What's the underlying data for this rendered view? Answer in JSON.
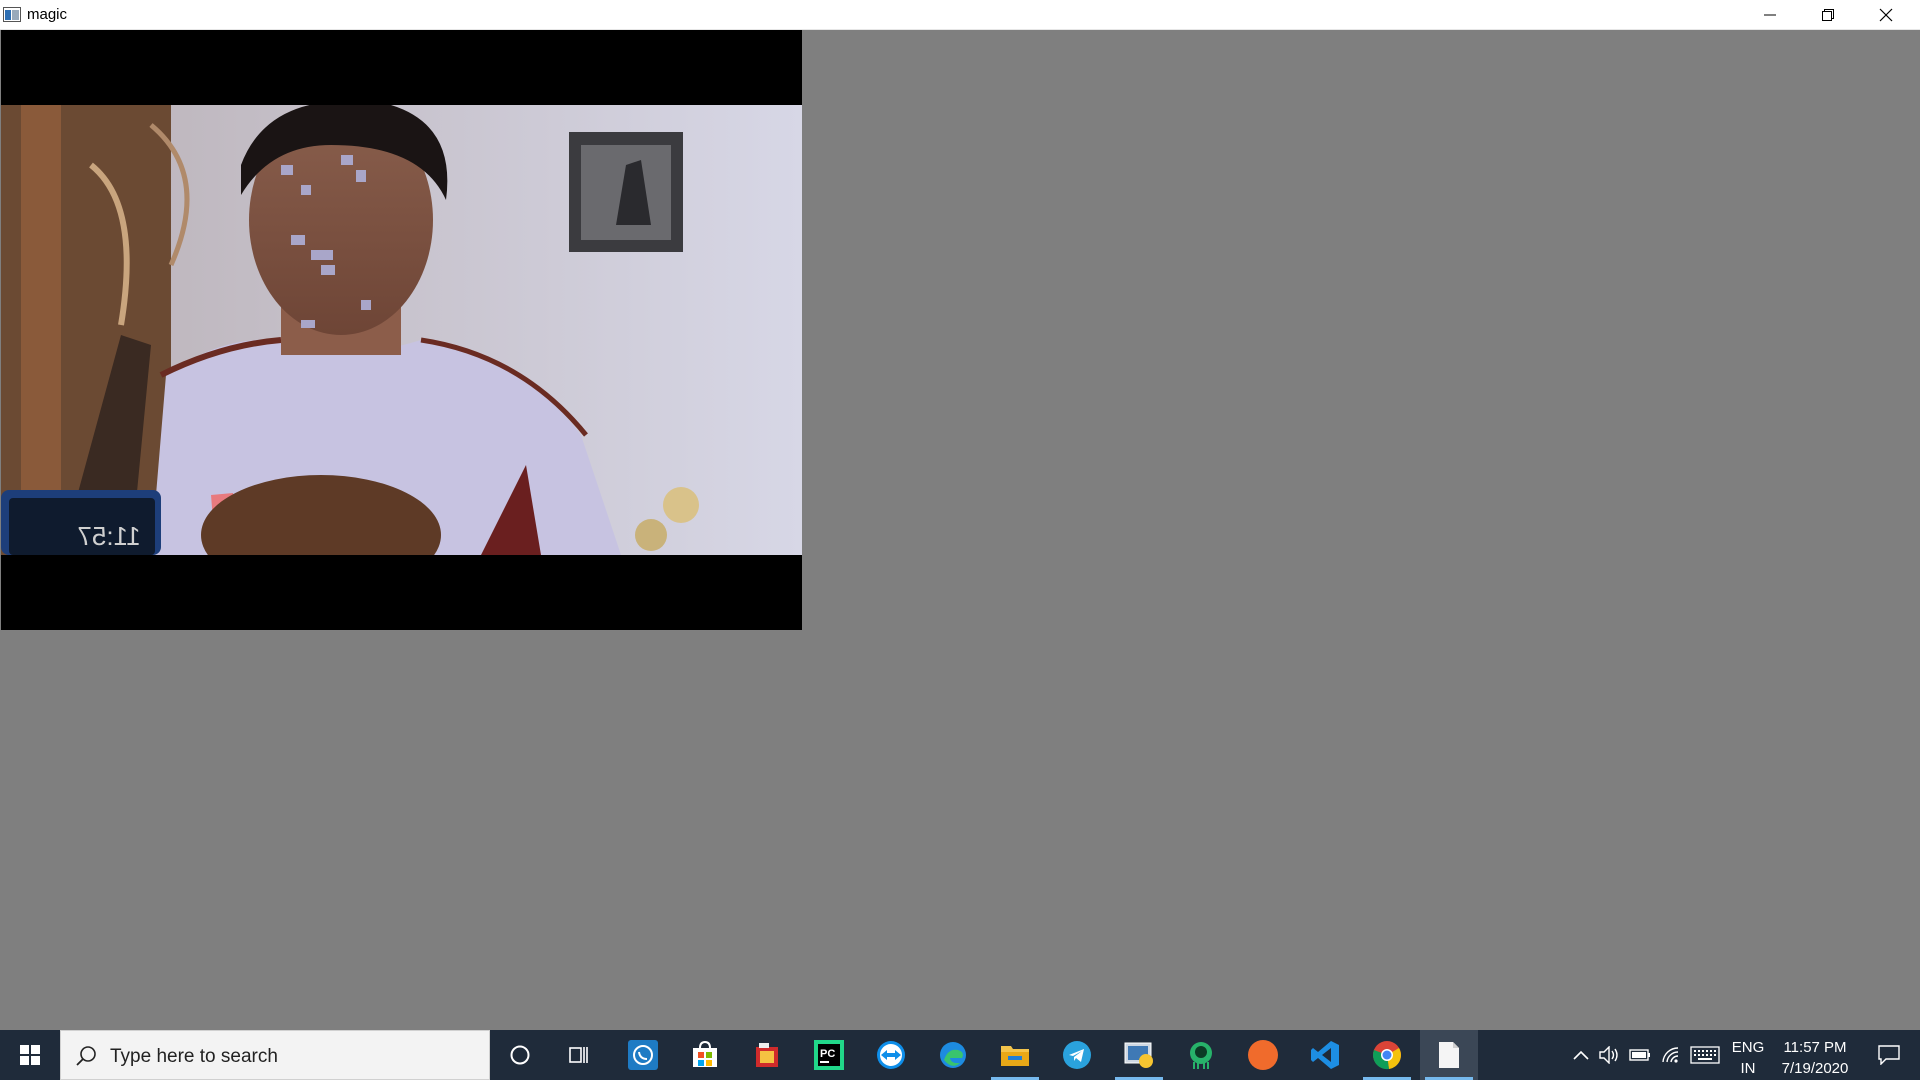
{
  "window": {
    "title": "magic",
    "controls": {
      "minimize": "minimize-icon",
      "restore": "restore-icon",
      "close": "close-icon"
    }
  },
  "video": {
    "clock_overlay": "11:57",
    "colors": {
      "letterbox": "#000000",
      "background": "#7f7f7f"
    }
  },
  "taskbar": {
    "search_placeholder": "Type here to search",
    "apps": [
      {
        "name": "cortana-icon"
      },
      {
        "name": "task-view-icon"
      },
      {
        "name": "whatsapp-icon"
      },
      {
        "name": "microsoft-store-icon"
      },
      {
        "name": "snip-tool-icon"
      },
      {
        "name": "pycharm-icon",
        "label": "PC"
      },
      {
        "name": "teamviewer-icon"
      },
      {
        "name": "edge-icon"
      },
      {
        "name": "file-explorer-icon"
      },
      {
        "name": "telegram-icon"
      },
      {
        "name": "python-app-icon"
      },
      {
        "name": "gitkraken-icon"
      },
      {
        "name": "compass-icon"
      },
      {
        "name": "vscode-icon"
      },
      {
        "name": "chrome-icon"
      },
      {
        "name": "document-icon"
      }
    ],
    "tray": {
      "lang_line1": "ENG",
      "lang_line2": "IN",
      "time": "11:57 PM",
      "date": "7/19/2020"
    },
    "colors": {
      "taskbar": "#1f2b3a",
      "indicator": "#76b9ed"
    }
  }
}
